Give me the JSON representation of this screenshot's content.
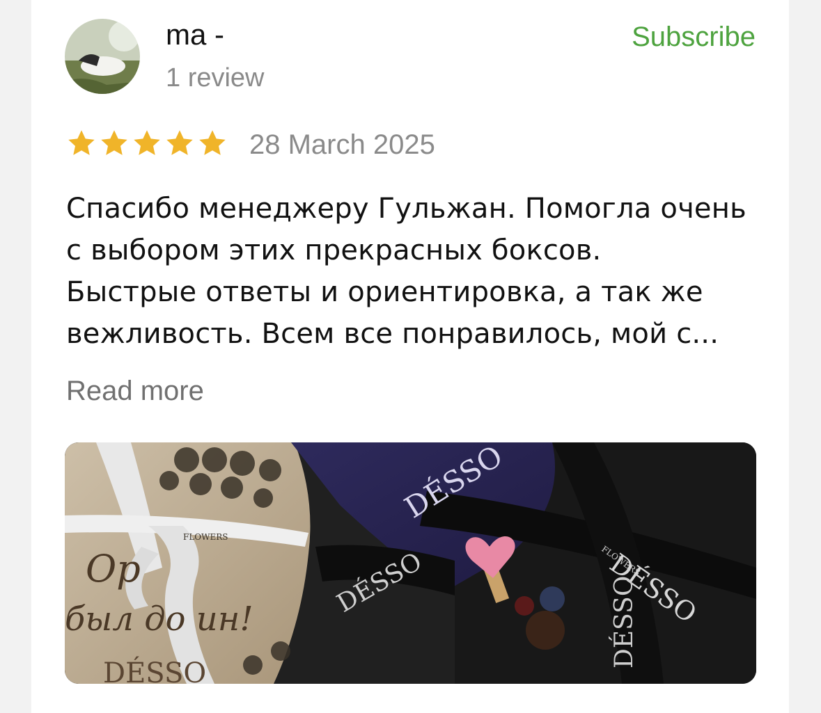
{
  "author": {
    "name": "ma -",
    "review_count": "1 review",
    "subscribe_label": "Subscribe",
    "avatar_icon": "user-avatar"
  },
  "review": {
    "rating": 5,
    "max_rating": 5,
    "star_color": "#f0b429",
    "date": "28 March 2025",
    "text_lines": [
      "Спасибо менеджеру Гульжан. Помогла очень",
      "с выбором этих прекрасных боксов.",
      "Быстрые ответы и ориентировка, а так же",
      "вежливость. Всем все понравилось, мой с..."
    ],
    "read_more_label": "Read more"
  },
  "photo": {
    "brand": "DÉSSO",
    "brand_sub": "FLOWERS",
    "engraving_1": "Ор",
    "engraving_2": "был до    ин!"
  },
  "colors": {
    "accent_green": "#4ea33f",
    "muted_text": "#8a8a8a"
  }
}
